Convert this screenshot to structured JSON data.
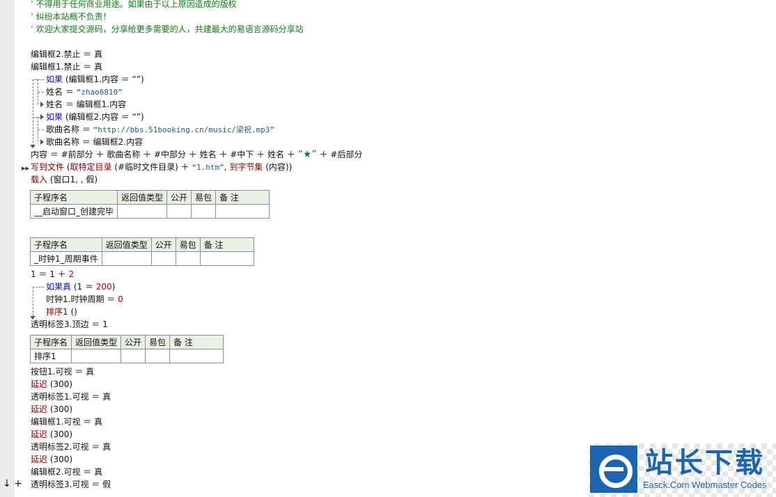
{
  "comments": [
    "’ 不得用于任何商业用途。如果由于以上原因造成的版权",
    "’ 纠纷本站概不负责！",
    "’ 欢迎大家提交源码，分享给更多需要的人，共建最大的易语言源码分享站"
  ],
  "block1": [
    "编辑框2.禁止 ＝ 真",
    "编辑框1.禁止 ＝ 真"
  ],
  "if1": {
    "kw": "如果",
    "cond": " (编辑框1.内容 ＝ “”)"
  },
  "name1": {
    "lhs": "姓名 ＝ ",
    "str": "“zhao6810”"
  },
  "name2": "姓名 ＝ 编辑框1.内容",
  "if2": {
    "kw": "如果",
    "cond": " (编辑框2.内容 ＝ “”)"
  },
  "song1": {
    "lhs": "歌曲名称 ＝ ",
    "str": "“http://bbs.51booking.cn/music/梁祝.mp3”"
  },
  "song2": "歌曲名称 ＝ 编辑框2.内容",
  "content": {
    "a": "内容 ＝ #前部分 ＋ 歌曲名称 ＋ #中部分 ＋ 姓名 ＋ #中下 ＋ 姓名 ＋ ",
    "star": "“★”",
    "b": " ＋ #后部分"
  },
  "write": {
    "cmd": "写到文件",
    "a": " (",
    "cmd2": "取特定目录",
    "b": " (#临时文件目录) ＋ ",
    "str": "“1.htm”",
    "c": ", ",
    "cmd3": "到字节集",
    "d": " (内容))"
  },
  "load": {
    "cmd": "载入",
    "args": " (窗口1, , 假)"
  },
  "table_headers": [
    "子程序名",
    "返回值类型",
    "公开",
    "易包",
    "备 注"
  ],
  "sub1": "__启动窗口_创建完毕",
  "sub2": "_时钟1_周期事件",
  "calc": {
    "a": "1 ＝ 1 ＋ ",
    "num": "2"
  },
  "ifTrue": {
    "kw": "如果真",
    "a": " (1 ＝ ",
    "num": "200",
    "b": ")"
  },
  "timer": {
    "a": "时钟1.时钟周期 ＝ ",
    "num": "0"
  },
  "sortCall": {
    "cmd": "排序1",
    "args": " ()"
  },
  "topEdge": "透明标签3.顶边 ＝ 1",
  "sub3": "排序1",
  "tail": [
    {
      "text": "按钮1.可视 ＝ 真",
      "type": "plain"
    },
    {
      "cmd": "延迟",
      "args": " (300)",
      "type": "delay"
    },
    {
      "text": "透明标签1.可视 ＝ 真",
      "type": "plain"
    },
    {
      "cmd": "延迟",
      "args": " (300)",
      "type": "delay"
    },
    {
      "text": "编辑框1.可视 ＝ 真",
      "type": "plain"
    },
    {
      "cmd": "延迟",
      "args": " (300)",
      "type": "delay"
    },
    {
      "text": "透明标签2.可视 ＝ 真",
      "type": "plain"
    },
    {
      "cmd": "延迟",
      "args": " (300)",
      "type": "delay"
    },
    {
      "text": "编辑框2.可视 ＝ 真",
      "type": "plain"
    },
    {
      "text": "透明标签3.可视 ＝ 假",
      "type": "plain"
    }
  ],
  "gutter_glyph": "↓ +",
  "watermark": {
    "title": "站长下载",
    "subtitle": "Easck.Com Webmaster Codes"
  },
  "colors": {
    "comment": "#0a7d12",
    "flow": "#1010a8",
    "command": "#8b0000",
    "string": "#1b5f80",
    "number": "#b00000",
    "brand": "#1a64b0"
  }
}
